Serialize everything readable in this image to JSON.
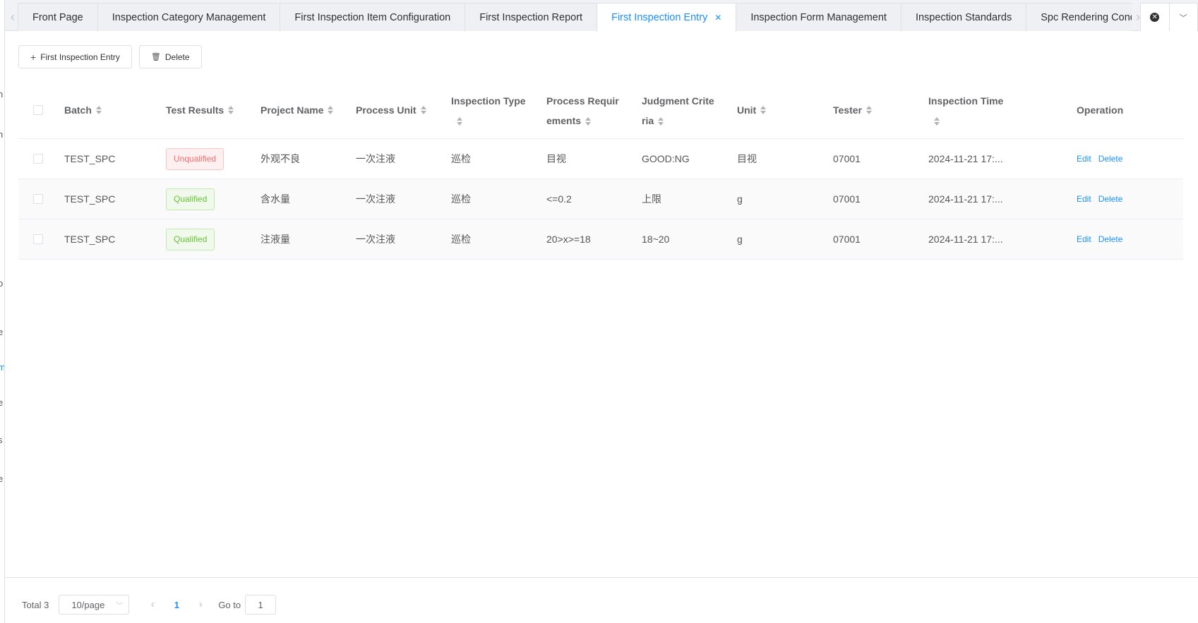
{
  "sidebar_fragments": [
    "n",
    "n",
    "o",
    "e",
    "m",
    "e",
    "s",
    "e"
  ],
  "tabs": [
    {
      "label": "Front Page"
    },
    {
      "label": "Inspection Category Management"
    },
    {
      "label": "First Inspection Item Configuration"
    },
    {
      "label": "First Inspection Report"
    },
    {
      "label": "First Inspection Entry",
      "active": true
    },
    {
      "label": "Inspection Form Management"
    },
    {
      "label": "Inspection Standards"
    },
    {
      "label": "Spc Rendering Condit"
    }
  ],
  "toolbar": {
    "add_label": "First Inspection Entry",
    "delete_label": "Delete"
  },
  "table": {
    "headers": {
      "batch": "Batch",
      "result": "Test Results",
      "project": "Project Name",
      "process_unit": "Process Unit",
      "type": "Inspection Type",
      "requirements": "Process Requirements",
      "criteria": "Judgment Criteria",
      "unit": "Unit",
      "tester": "Tester",
      "time": "Inspection Time",
      "operation": "Operation"
    },
    "rows": [
      {
        "batch": "TEST_SPC",
        "result": "Unqualified",
        "project": "外观不良",
        "process_unit": "一次注液",
        "type": "巡检",
        "requirements": "目视",
        "criteria": "GOOD:NG",
        "unit": "目视",
        "tester": "07001",
        "time": "2024-11-21 17:..."
      },
      {
        "batch": "TEST_SPC",
        "result": "Qualified",
        "project": "含水量",
        "process_unit": "一次注液",
        "type": "巡检",
        "requirements": "<=0.2",
        "criteria": "上限",
        "unit": "g",
        "tester": "07001",
        "time": "2024-11-21 17:..."
      },
      {
        "batch": "TEST_SPC",
        "result": "Qualified",
        "project": "注液量",
        "process_unit": "一次注液",
        "type": "巡检",
        "requirements": "20>x>=18",
        "criteria": "18~20",
        "unit": "g",
        "tester": "07001",
        "time": "2024-11-21 17:..."
      }
    ],
    "edit_label": "Edit",
    "delete_label": "Delete"
  },
  "pagination": {
    "total": "Total 3",
    "page_size": "10/page",
    "current_page": "1",
    "goto_label": "Go to",
    "goto_value": "1"
  }
}
